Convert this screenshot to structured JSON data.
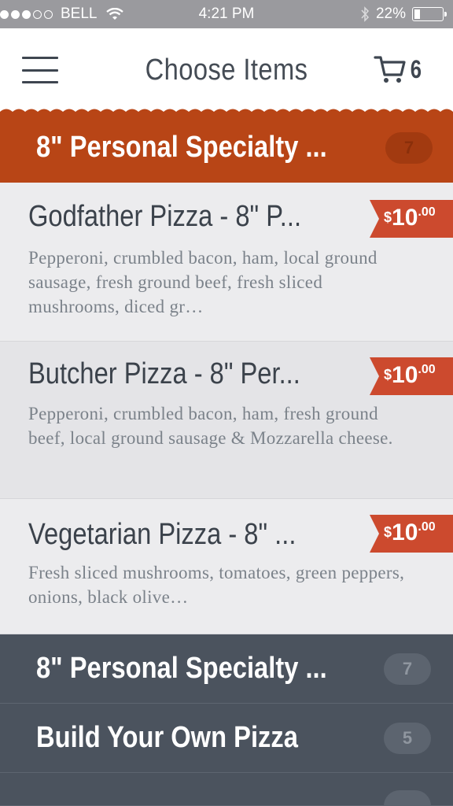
{
  "status_bar": {
    "carrier": "BELL",
    "time": "4:21 PM",
    "battery": "22%",
    "battery_level": 0.22
  },
  "header": {
    "title": "Choose Items",
    "cart_count": "6"
  },
  "active_category": {
    "label": "8\" Personal Specialty ...",
    "count": "7"
  },
  "items": [
    {
      "title": "Godfather Pizza - 8\" P...",
      "description": "Pepperoni, crumbled bacon, ham, local ground sausage, fresh ground beef, fresh sliced mushrooms, diced gr…",
      "price_currency": "$",
      "price_main": "10",
      "price_cents": ".00"
    },
    {
      "title": "Butcher Pizza - 8\" Per...",
      "description": "Pepperoni, crumbled bacon, ham, fresh ground beef, local ground sausage & Mozzarella cheese.",
      "price_currency": "$",
      "price_main": "10",
      "price_cents": ".00"
    },
    {
      "title": "Vegetarian Pizza - 8\" ...",
      "description": "Fresh sliced mushrooms, tomatoes, green peppers, onions, black olive…",
      "price_currency": "$",
      "price_main": "10",
      "price_cents": ".00"
    }
  ],
  "categories": [
    {
      "label": "8\" Personal Specialty ...",
      "count": "7"
    },
    {
      "label": "Build Your Own Pizza",
      "count": "5"
    }
  ],
  "icons": {
    "menu": "hamburger-menu-icon",
    "cart": "cart-icon",
    "wifi": "wifi-icon",
    "bluetooth": "bluetooth-icon",
    "battery": "battery-icon"
  },
  "colors": {
    "accent": "#b84516",
    "price_tag": "#cc4a2e",
    "category_dark": "#4b535e"
  }
}
